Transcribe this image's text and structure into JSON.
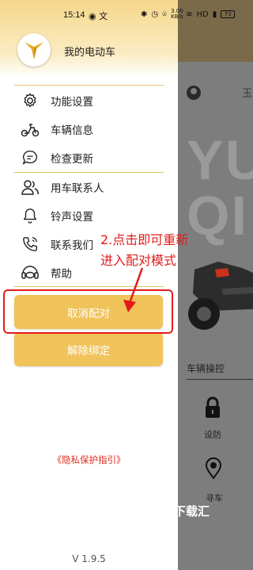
{
  "status_bar": {
    "time": "15:14",
    "icons_left": "◉ 文",
    "net_speed": "3.00 KB/s",
    "hd": "HD",
    "battery": "73"
  },
  "drawer": {
    "app_title": "我的电动车",
    "menu_group_1": [
      {
        "label": "功能设置",
        "icon": "gear-icon"
      },
      {
        "label": "车辆信息",
        "icon": "scooter-icon"
      },
      {
        "label": "检查更新",
        "icon": "chat-bubble-icon"
      }
    ],
    "menu_group_2": [
      {
        "label": "用车联系人",
        "icon": "contacts-icon"
      },
      {
        "label": "铃声设置",
        "icon": "bell-icon"
      },
      {
        "label": "联系我们",
        "icon": "phone-icon"
      },
      {
        "label": "帮助",
        "icon": "headset-icon"
      }
    ],
    "unpair_button": "取消配对",
    "unbind_button": "解除绑定",
    "privacy_link": "《隐私保护指引》",
    "version": "V 1.9.5"
  },
  "annotation": {
    "line1": "2.点击即可重新",
    "line2": "进入配对模式"
  },
  "background_app": {
    "top_text": "玉",
    "big_text_1": "YU",
    "big_text_2": "QI",
    "section_title": "车辆操控",
    "lock_label": "设防",
    "find_label": "寻车",
    "watermark": "下载汇"
  },
  "colors": {
    "accent_gold": "#f0c35b",
    "annotation_red": "#e31b1b",
    "privacy_red": "#e0281e"
  }
}
